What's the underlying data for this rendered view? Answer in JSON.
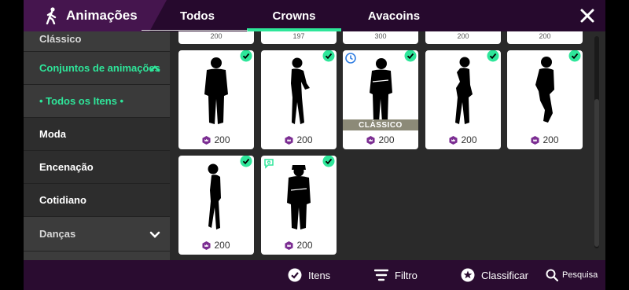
{
  "header": {
    "section_title": "Animações",
    "tabs": [
      {
        "label": "Todos"
      },
      {
        "label": "Crowns"
      },
      {
        "label": "Avacoins"
      }
    ],
    "active_tab": "Crowns",
    "colors": {
      "accent": "#2ee69a",
      "header_bg": "#26092d",
      "title_tab_bg": "#45154e"
    }
  },
  "sidebar": {
    "items": [
      {
        "label": "Clássico"
      },
      {
        "label": "Conjuntos de animações"
      },
      {
        "label": "• Todos os Itens •"
      },
      {
        "label": "Moda"
      },
      {
        "label": "Encenação"
      },
      {
        "label": "Cotidiano"
      },
      {
        "label": "Danças"
      }
    ]
  },
  "grid": {
    "top_row_partial_prices": [
      "200",
      "197",
      "300",
      "200",
      "200"
    ],
    "cards": [
      {
        "price": "200",
        "owned": true,
        "pose": "standing-hands-pockets"
      },
      {
        "price": "200",
        "owned": true,
        "pose": "woman-hand-hip"
      },
      {
        "price": "200",
        "owned": true,
        "pose": "arms-crossed-thinking",
        "tag": "CLÁSSICO",
        "badge_icon": "clock-icon"
      },
      {
        "price": "200",
        "owned": true,
        "pose": "woman-hand-head"
      },
      {
        "price": "200",
        "owned": true,
        "pose": "man-leaning-back"
      },
      {
        "price": "200",
        "owned": true,
        "pose": "woman-head-tilted"
      },
      {
        "price": "200",
        "owned": true,
        "pose": "man-arms-crossed",
        "badge_icon": "chat-icon"
      }
    ],
    "currency_icon": "crown-gem-icon"
  },
  "bottombar": {
    "items_label": "Itens",
    "filter_label": "Filtro",
    "sort_label": "Classificar",
    "search_label": "Pesquisa"
  }
}
